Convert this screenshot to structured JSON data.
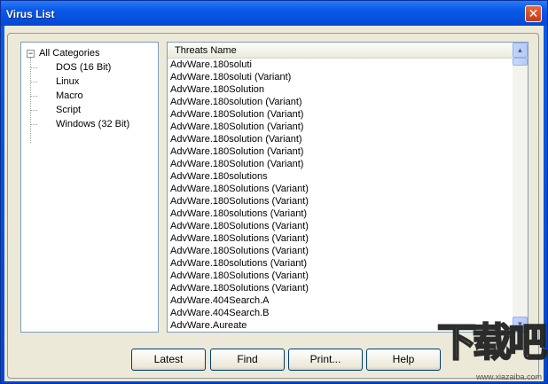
{
  "window": {
    "title": "Virus List",
    "close_glyph": "✕"
  },
  "tree": {
    "root_label": "All Categories",
    "expander_glyph": "−",
    "children": [
      "DOS (16 Bit)",
      "Linux",
      "Macro",
      "Script",
      "Windows (32 Bit)"
    ]
  },
  "list": {
    "column_header": "Threats Name",
    "rows": [
      "AdvWare.180soluti",
      "AdvWare.180soluti (Variant)",
      "AdvWare.180Solution",
      "AdvWare.180solution (Variant)",
      "AdvWare.180Solution (Variant)",
      "AdvWare.180Solution (Variant)",
      "AdvWare.180solution (Variant)",
      "AdvWare.180Solution (Variant)",
      "AdvWare.180Solution (Variant)",
      "AdvWare.180solutions",
      "AdvWare.180Solutions (Variant)",
      "AdvWare.180Solutions (Variant)",
      "AdvWare.180solutions (Variant)",
      "AdvWare.180Solutions (Variant)",
      "AdvWare.180Solutions (Variant)",
      "AdvWare.180Solutions (Variant)",
      "AdvWare.180solutions (Variant)",
      "AdvWare.180Solutions (Variant)",
      "AdvWare.180Solutions (Variant)",
      "AdvWare.404Search.A",
      "AdvWare.404Search.B",
      "AdvWare.Aureate"
    ]
  },
  "scrollbar": {
    "up_glyph": "▲",
    "down_glyph": "▼"
  },
  "buttons": {
    "latest": "Latest",
    "find": "Find",
    "print": "Print...",
    "help": "Help"
  },
  "watermark": {
    "logo": "下载吧",
    "url": "www.xiazaiba.com"
  },
  "colors": {
    "title_bar": "#0650df",
    "dialog_bg": "#ece9d8",
    "close_button": "#c33b17"
  }
}
